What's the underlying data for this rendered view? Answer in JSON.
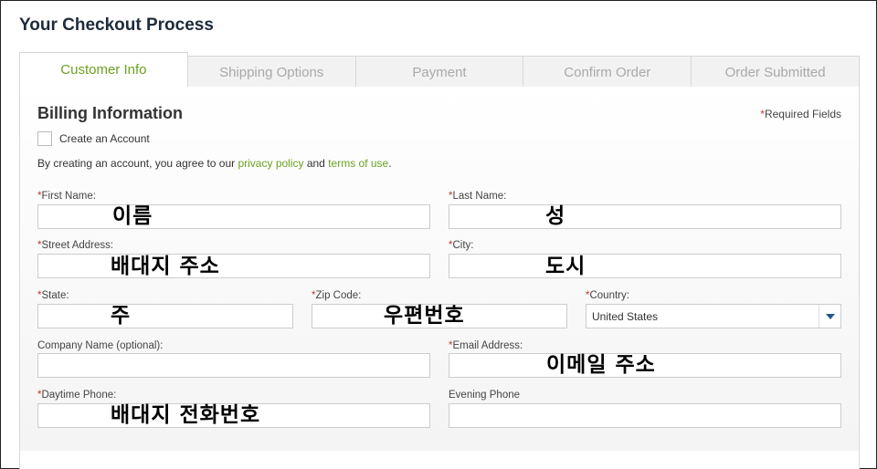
{
  "page": {
    "title": "Your Checkout Process"
  },
  "tabs": [
    {
      "label": "Customer Info",
      "active": true
    },
    {
      "label": "Shipping Options",
      "active": false
    },
    {
      "label": "Payment",
      "active": false
    },
    {
      "label": "Confirm Order",
      "active": false
    },
    {
      "label": "Order Submitted",
      "active": false
    }
  ],
  "billing": {
    "title": "Billing Information",
    "required_mark": "*",
    "required_note": "Required Fields",
    "create_account_label": "Create an Account",
    "agree_prefix": "By creating an account, you agree to our ",
    "privacy_link": "privacy policy",
    "agree_and": " and ",
    "terms_link": "terms of use",
    "agree_suffix": "."
  },
  "fields": {
    "first_name": {
      "label": "First Name:",
      "required": true,
      "overlay": "이름"
    },
    "last_name": {
      "label": "Last Name:",
      "required": true,
      "overlay": "성"
    },
    "street_address": {
      "label": "Street Address:",
      "required": true,
      "overlay": "배대지 주소"
    },
    "city": {
      "label": "City:",
      "required": true,
      "overlay": "도시"
    },
    "state": {
      "label": "State:",
      "required": true,
      "overlay": "주"
    },
    "zip_code": {
      "label": "Zip Code:",
      "required": true,
      "overlay": "우편번호"
    },
    "country": {
      "label": "Country:",
      "required": true,
      "value": "United States"
    },
    "company_name": {
      "label": "Company Name (optional):",
      "required": false
    },
    "email_address": {
      "label": "Email Address:",
      "required": true,
      "overlay": "이메일 주소"
    },
    "daytime_phone": {
      "label": "Daytime Phone:",
      "required": true,
      "overlay": "배대지 전화번호"
    },
    "evening_phone": {
      "label": "Evening Phone",
      "required": false
    }
  },
  "colors": {
    "accent_green": "#6aa121",
    "required_red": "#c0392b",
    "arrow_blue": "#1f5a8a"
  }
}
